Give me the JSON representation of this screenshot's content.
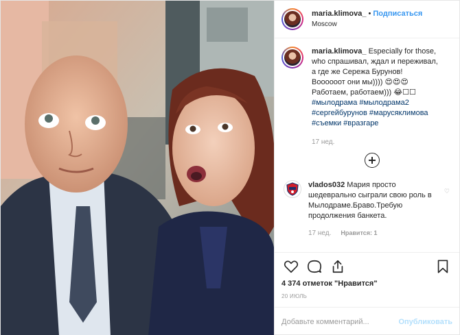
{
  "header": {
    "username": "maria.klimova_",
    "separator": "•",
    "follow_label": "Подписаться",
    "location": "Moscow"
  },
  "caption": {
    "username": "maria.klimova_",
    "lines": [
      "Especially for those,",
      "who спрашивал, ждал и переживал,",
      "а где же Сережа Бурунов!",
      "Воооооот они мы)))) 😍😍😍",
      "Работаем, работаем))) 😂☐☐"
    ],
    "hashtags": [
      "#мылодрама #мылодрама2",
      "#сергейбурунов #марусяклимова",
      "#съемки #вразгаре"
    ],
    "time": "17 нед."
  },
  "comment": {
    "username": "vlados032",
    "text": "Мария просто шедеврально сыграли свою роль в Мылодраме.Браво.Требую продолжения банкета.",
    "time": "17 нед.",
    "likes": "Нравится: 1"
  },
  "likes_text": "4 374 отметок \"Нравится\"",
  "date": "20 ИЮЛЬ",
  "add_comment": {
    "placeholder": "Добавьте комментарий...",
    "publish_label": "Опубликовать"
  },
  "icons": {
    "heart": "heart-icon",
    "comment": "comment-icon",
    "share": "share-icon",
    "bookmark": "bookmark-icon",
    "plus": "load-more-icon"
  },
  "colors": {
    "link_blue": "#3897f0",
    "hashtag": "#003569",
    "muted": "#999999",
    "publish_disabled": "#b2dffc"
  }
}
